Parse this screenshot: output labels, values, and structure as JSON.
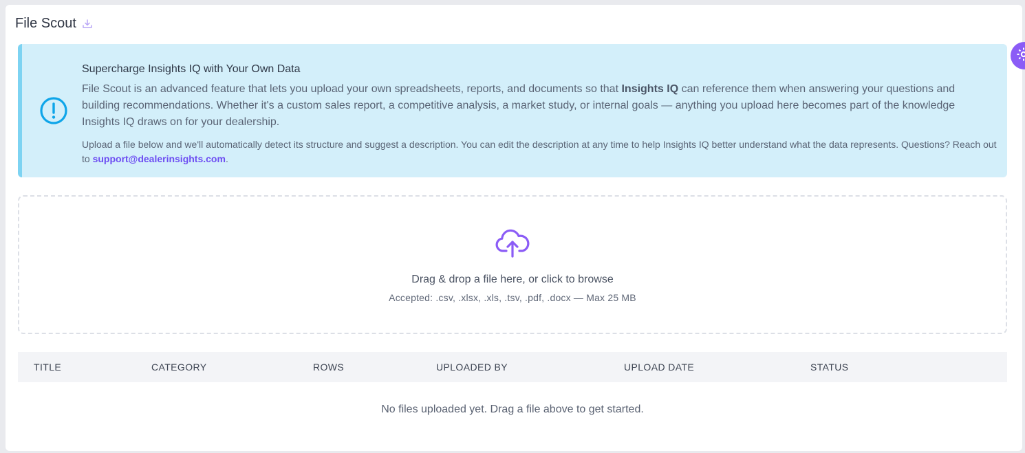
{
  "page": {
    "title": "File Scout",
    "export_icon": "download-icon"
  },
  "floating_button": {
    "icon": "gear-icon",
    "color": "#8b5cf6"
  },
  "alert": {
    "icon": "exclamation-circle-icon",
    "title": "Supercharge Insights IQ with Your Own Data",
    "body_before": "File Scout is an advanced feature that lets you upload your own spreadsheets, reports, and documents so that ",
    "body_bold": "Insights IQ",
    "body_after": " can reference them when answering your questions and building recommendations. Whether it's a custom sales report, a competitive analysis, a market study, or internal goals — anything you upload here becomes part of the knowledge Insights IQ draws on for your dealership.",
    "note": "Upload a file below and we'll automatically detect its structure and suggest a description. You can edit the description at any time to help Insights IQ better understand what the data represents. Questions? Reach out to ",
    "support_email": "support@dealerinsights.com",
    "note_end": ".",
    "background": "#d3effa",
    "accent": "#7dd3f2"
  },
  "dropzone": {
    "icon": "cloud-upload-icon",
    "title": "Drag & drop a file here, or click to browse",
    "accepted": "Accepted: .csv, .xlsx, .xls, .tsv, .pdf, .docx — Max 25 MB",
    "accent": "#8b5cf6"
  },
  "table": {
    "columns": [
      "TITLE",
      "CATEGORY",
      "ROWS",
      "UPLOADED BY",
      "UPLOAD DATE",
      "STATUS"
    ],
    "empty_message": "No files uploaded yet. Drag a file above to get started."
  }
}
